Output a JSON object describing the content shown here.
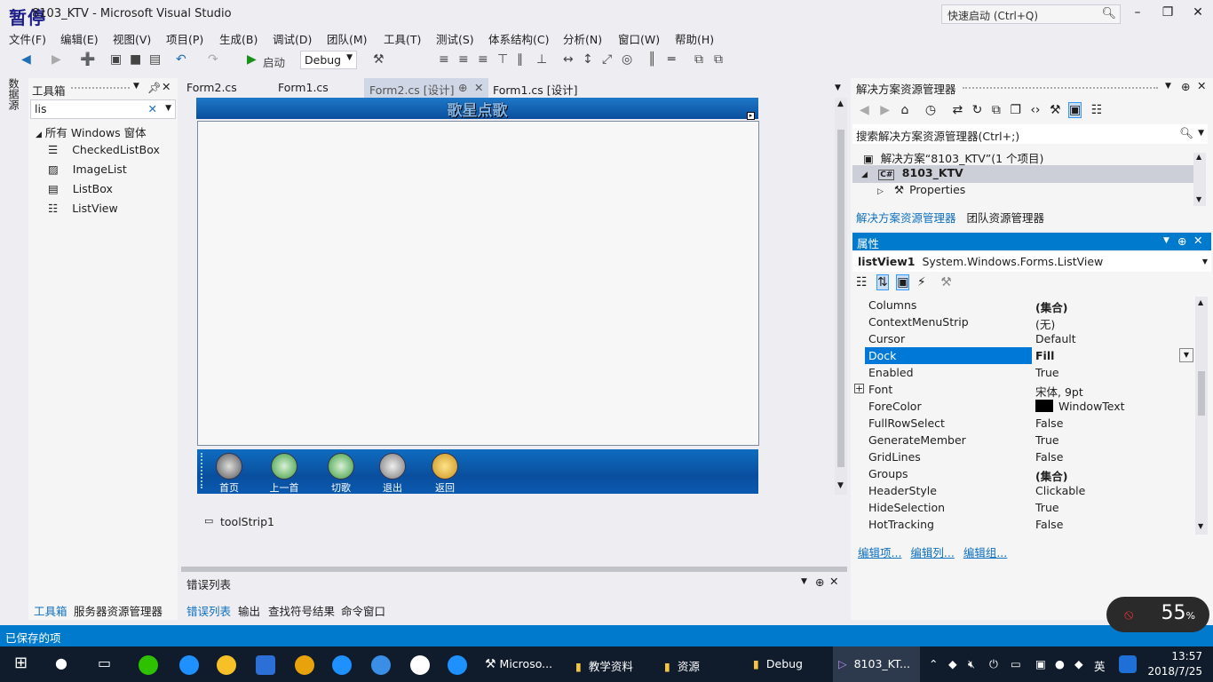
{
  "window": {
    "overlay_label": "暂停",
    "title": "8103_KTV - Microsoft Visual Studio",
    "quick_launch_placeholder": "快速启动 (Ctrl+Q)"
  },
  "menu": [
    "文件(F)",
    "编辑(E)",
    "视图(V)",
    "项目(P)",
    "生成(B)",
    "调试(D)",
    "团队(M)",
    "工具(T)",
    "测试(S)",
    "体系结构(C)",
    "分析(N)",
    "窗口(W)",
    "帮助(H)"
  ],
  "toolbar": {
    "start_label": "启动",
    "config": "Debug"
  },
  "left_vertical_tab": "数据源",
  "toolbox": {
    "title": "工具箱",
    "search_value": "lis",
    "group": "所有 Windows 窗体",
    "items": [
      "CheckedListBox",
      "ImageList",
      "ListBox",
      "ListView"
    ],
    "footer_tabs": [
      "工具箱",
      "服务器资源管理器"
    ]
  },
  "editor_tabs": [
    "Form2.cs",
    "Form1.cs",
    "Form2.cs [设计]",
    "Form1.cs [设计]"
  ],
  "designer": {
    "form_title": "歌星点歌",
    "strip_buttons": [
      "首页",
      "上一首",
      "切歌",
      "退出",
      "返回"
    ],
    "tray_item": "toolStrip1"
  },
  "error_list": {
    "title": "错误列表"
  },
  "bottom_tabs": [
    "错误列表",
    "输出",
    "查找符号结果",
    "命令窗口"
  ],
  "solution_explorer": {
    "title": "解决方案资源管理器",
    "search_placeholder": "搜索解决方案资源管理器(Ctrl+;)",
    "solution": "解决方案“8103_KTV”(1 个项目)",
    "project": "8103_KTV",
    "properties_node": "Properties",
    "tabs": [
      "解决方案资源管理器",
      "团队资源管理器"
    ]
  },
  "properties": {
    "title": "属性",
    "object": "listView1",
    "object_type": "System.Windows.Forms.ListView",
    "rows": [
      {
        "name": "Columns",
        "value": "(集合)",
        "bold": true
      },
      {
        "name": "ContextMenuStrip",
        "value": "(无)"
      },
      {
        "name": "Cursor",
        "value": "Default"
      },
      {
        "name": "Dock",
        "value": "Fill",
        "bold": true,
        "selected": true
      },
      {
        "name": "Enabled",
        "value": "True"
      },
      {
        "name": "Font",
        "value": "宋体, 9pt",
        "expandable": true
      },
      {
        "name": "ForeColor",
        "value": "WindowText",
        "swatch": "#000000"
      },
      {
        "name": "FullRowSelect",
        "value": "False"
      },
      {
        "name": "GenerateMember",
        "value": "True"
      },
      {
        "name": "GridLines",
        "value": "False"
      },
      {
        "name": "Groups",
        "value": "(集合)",
        "bold": true
      },
      {
        "name": "HeaderStyle",
        "value": "Clickable"
      },
      {
        "name": "HideSelection",
        "value": "True"
      },
      {
        "name": "HotTracking",
        "value": "False"
      }
    ],
    "links": [
      "编辑项...",
      "编辑列...",
      "编辑组..."
    ]
  },
  "status": {
    "text": "已保存的项"
  },
  "network_widget": {
    "percent": "55",
    "unit": "%"
  },
  "taskbar": {
    "items": [
      "Microso...",
      "教学资料",
      "资源",
      "Debug",
      "8103_KT..."
    ],
    "ime": "英",
    "time": "13:57",
    "date": "2018/7/25"
  },
  "colors": {
    "accent": "#007acc",
    "form_blue": "#0a4f9e",
    "taskbar": "#101c2c"
  }
}
